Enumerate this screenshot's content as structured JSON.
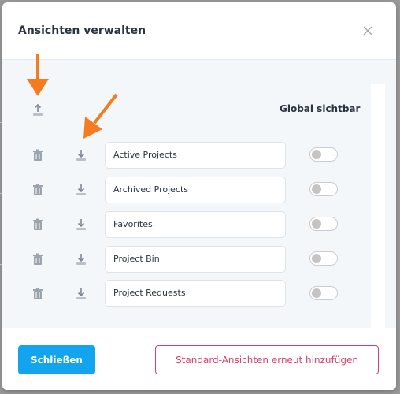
{
  "dialog": {
    "title": "Ansichten verwalten",
    "close_icon": "close-icon"
  },
  "table": {
    "header_icon": "upload-icon",
    "visibility_header": "Global sichtbar",
    "rows": [
      {
        "name": "Active Projects",
        "global_visible": false
      },
      {
        "name": "Archived Projects",
        "global_visible": false
      },
      {
        "name": "Favorites",
        "global_visible": false
      },
      {
        "name": "Project Bin",
        "global_visible": false
      },
      {
        "name": "Project Requests",
        "global_visible": false
      }
    ],
    "row_icons": [
      "trash-icon",
      "download-icon"
    ]
  },
  "footer": {
    "close_label": "Schließen",
    "restore_label": "Standard-Ansichten erneut hinzufügen"
  },
  "colors": {
    "primary": "#12a4ec",
    "danger": "#d63f6a",
    "annotation_arrow": "#f47b20"
  }
}
